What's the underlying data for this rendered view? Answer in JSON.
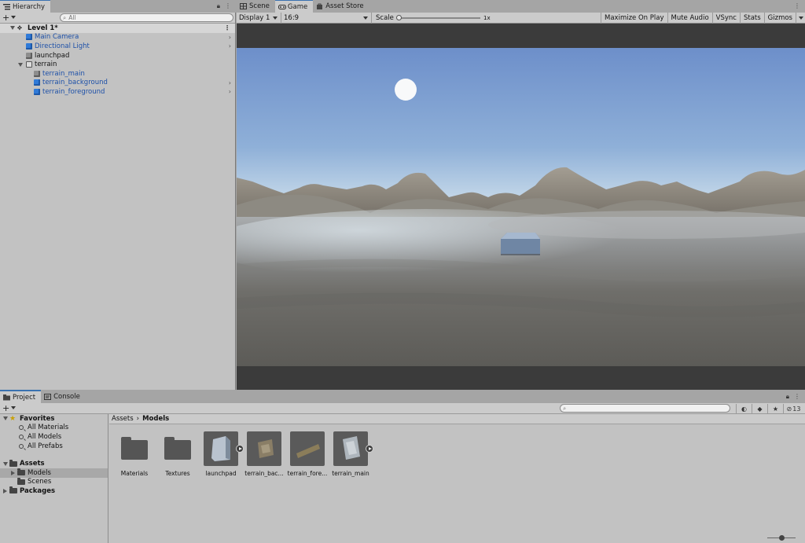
{
  "hierarchy": {
    "tab_label": "Hierarchy",
    "search_placeholder": "All",
    "scene": {
      "name": "Level 1*"
    },
    "items": [
      {
        "label": "Main Camera",
        "icon": "blue-cube-icon",
        "prefab": true
      },
      {
        "label": "Directional Light",
        "icon": "blue-cube-icon",
        "prefab": true
      },
      {
        "label": "launchpad",
        "icon": "gray-cube-icon",
        "prefab": false
      },
      {
        "label": "terrain",
        "icon": "hollow-cube-icon",
        "prefab": false
      },
      {
        "label": "terrain_main",
        "icon": "gray-cube-icon",
        "prefab": true
      },
      {
        "label": "terrain_background",
        "icon": "blue-cube-icon",
        "prefab": true
      },
      {
        "label": "terrain_foreground",
        "icon": "blue-cube-icon",
        "prefab": true
      }
    ]
  },
  "game": {
    "tabs": [
      {
        "label": "Scene",
        "icon": "scene-grid-icon"
      },
      {
        "label": "Game",
        "icon": "gamepad-icon"
      },
      {
        "label": "Asset Store",
        "icon": "store-bag-icon"
      }
    ],
    "active_tab": "Game",
    "display": "Display 1",
    "aspect": "16:9",
    "scale_label": "Scale",
    "scale_value": "1x",
    "buttons": [
      "Maximize On Play",
      "Mute Audio",
      "VSync",
      "Stats",
      "Gizmos"
    ]
  },
  "project": {
    "tabs": [
      {
        "label": "Project",
        "icon": "folder-icon"
      },
      {
        "label": "Console",
        "icon": "console-icon"
      }
    ],
    "favorites": {
      "label": "Favorites",
      "items": [
        "All Materials",
        "All Models",
        "All Prefabs"
      ]
    },
    "assets": {
      "label": "Assets",
      "children": [
        "Models",
        "Scenes"
      ]
    },
    "packages": {
      "label": "Packages"
    },
    "breadcrumb": [
      "Assets",
      "Models"
    ],
    "hidden_count": "13",
    "grid_items": [
      {
        "name": "Materials",
        "kind": "folder"
      },
      {
        "name": "Textures",
        "kind": "folder"
      },
      {
        "name": "launchpad",
        "kind": "model"
      },
      {
        "name": "terrain_bac...",
        "kind": "model"
      },
      {
        "name": "terrain_fore...",
        "kind": "model"
      },
      {
        "name": "terrain_main",
        "kind": "model"
      }
    ]
  },
  "colors": {
    "accent": "#3a72b0",
    "prefab_text": "#1d50a8",
    "panel_bg": "#c2c2c2"
  }
}
